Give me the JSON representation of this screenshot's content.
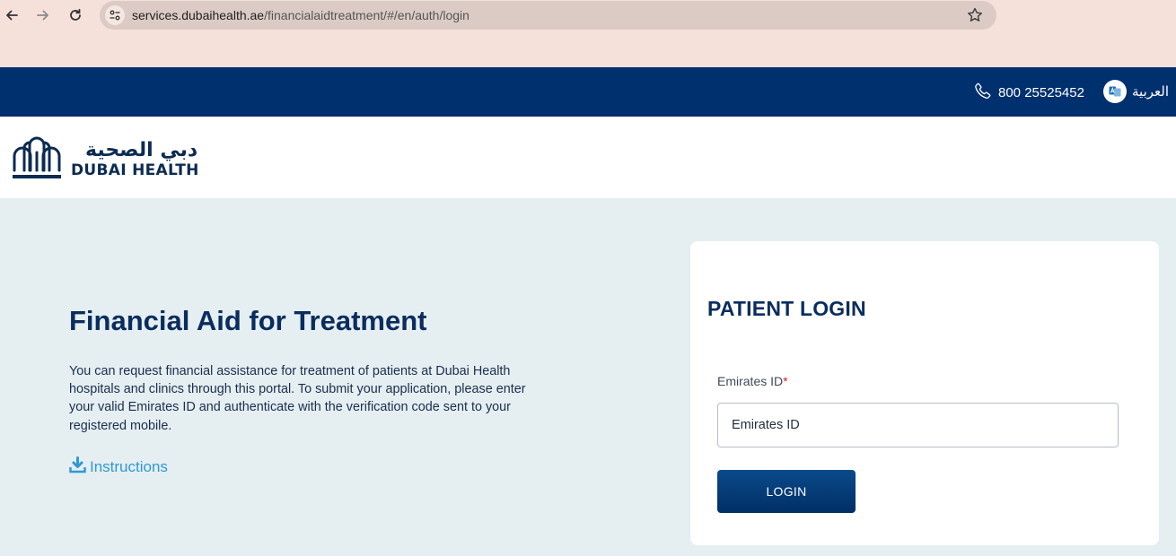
{
  "browser": {
    "url_host": "services.dubaihealth.ae",
    "url_path": "/financialaidtreatment/#/en/auth/login"
  },
  "header": {
    "phone": "800 25525452",
    "language": "العربية"
  },
  "logo": {
    "arabic": "دبي الصحية",
    "english": "DUBAI HEALTH"
  },
  "intro": {
    "title": "Financial Aid for Treatment",
    "description": "You can request financial assistance for treatment of patients at Dubai Health hospitals and clinics through this portal. To submit your application, please enter your valid Emirates ID and authenticate with the verification code sent to your registered mobile.",
    "instructions_label": "Instructions"
  },
  "login": {
    "title": "PATIENT LOGIN",
    "emirates_label": "Emirates ID",
    "required_mark": "*",
    "emirates_placeholder": "Emirates ID",
    "button_label": "LOGIN"
  },
  "colors": {
    "header_bg": "#00306e",
    "primary_text": "#0a2d5e",
    "link": "#3198d4",
    "page_bg": "#e5eef1"
  }
}
